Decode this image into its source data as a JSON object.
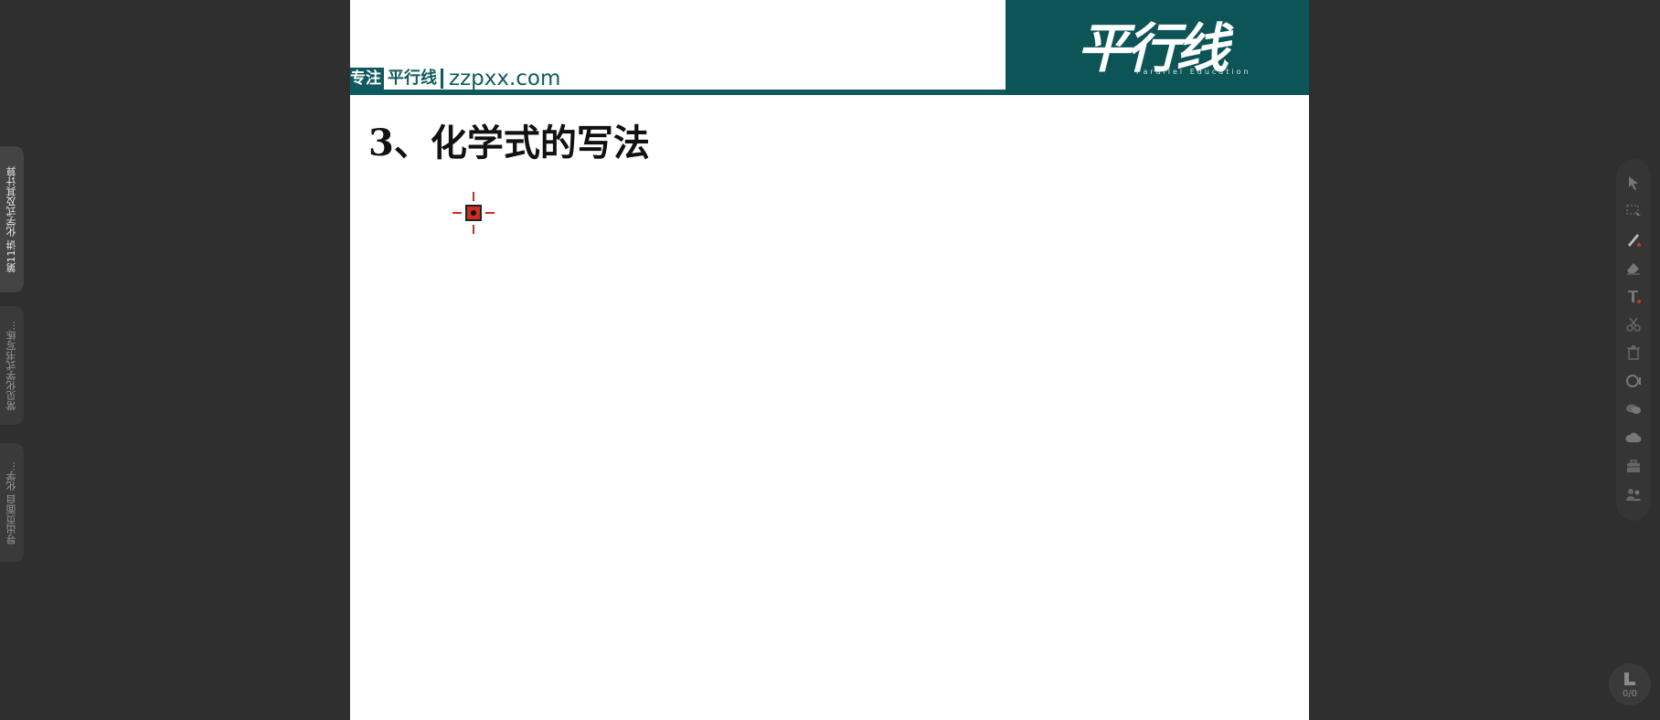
{
  "left_tabs": [
    {
      "label": "第11讲 化学式及其计算",
      "active": true
    },
    {
      "label": "常见化学式书写练...",
      "active": false
    },
    {
      "label": "导出页面自 化学...",
      "active": false
    }
  ],
  "slide": {
    "site_prefix": "专注",
    "site_brand": "平行线",
    "site_url": "zzpxx.com",
    "logo_text": "平行线",
    "logo_sub": "Parallel Education",
    "title": "3、化学式的写法"
  },
  "toolbar": {
    "tools": [
      "pointer-icon",
      "selection-icon",
      "pen-icon",
      "eraser-icon",
      "text-icon",
      "scissors-icon",
      "trash-icon",
      "record-icon",
      "chat-icon",
      "cloud-icon",
      "toolbox-icon",
      "users-icon"
    ]
  },
  "page_indicator": {
    "count": "0/0"
  },
  "colors": {
    "brand_teal": "#0f5a5e",
    "background": "#2f2f2f",
    "cursor_red": "#d22b1f"
  }
}
